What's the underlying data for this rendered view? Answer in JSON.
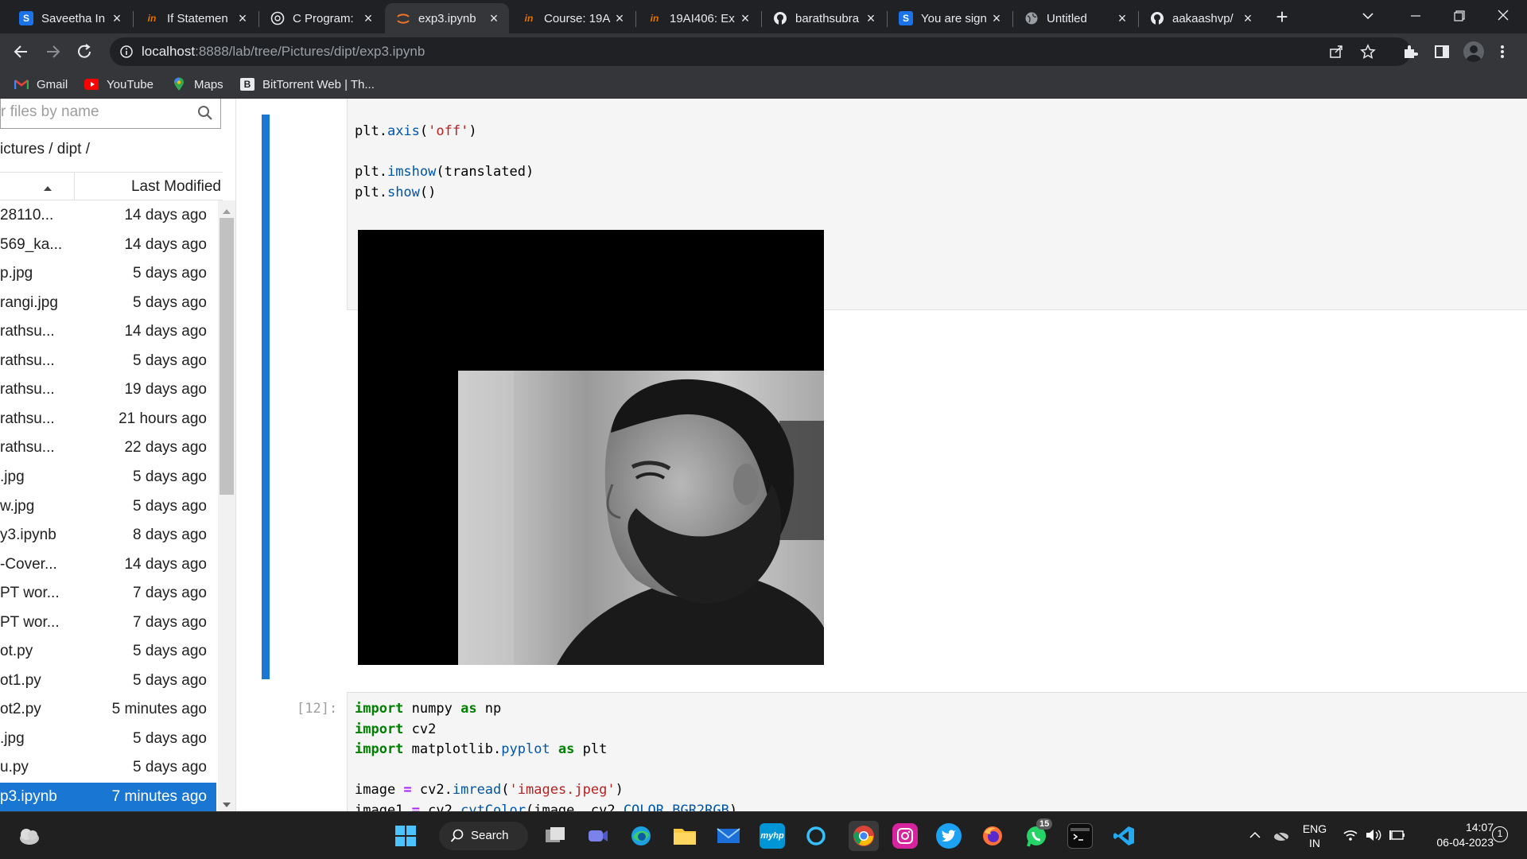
{
  "browser": {
    "tabs": [
      {
        "title": "Saveetha In",
        "icon": "saveetha-s-icon",
        "color": "#1a73e8"
      },
      {
        "title": "If Statemen",
        "icon": "unstop-icon",
        "color": "#e37400"
      },
      {
        "title": "C Program:",
        "icon": "chatgpt-icon",
        "color": "#10a37f"
      },
      {
        "title": "exp3.ipynb",
        "icon": "jupyter-icon",
        "color": "#f37626",
        "active": true
      },
      {
        "title": "Course: 19A",
        "icon": "unstop-icon",
        "color": "#e37400"
      },
      {
        "title": "19AI406: Ex",
        "icon": "unstop-icon",
        "color": "#e37400"
      },
      {
        "title": "barathsubra",
        "icon": "github-icon",
        "color": "#ffffff"
      },
      {
        "title": "You are sign",
        "icon": "saveetha-s-icon",
        "color": "#1a73e8"
      },
      {
        "title": "Untitled",
        "icon": "globe-icon",
        "color": "#9aa0a6"
      },
      {
        "title": "aakaashvp/",
        "icon": "github-icon",
        "color": "#ffffff"
      }
    ],
    "url_host": "localhost",
    "url_path": ":8888/lab/tree/Pictures/dipt/exp3.ipynb",
    "bookmarks": [
      {
        "label": "Gmail",
        "icon": "gmail-icon"
      },
      {
        "label": "YouTube",
        "icon": "youtube-icon"
      },
      {
        "label": "Maps",
        "icon": "maps-icon"
      },
      {
        "label": "BitTorrent Web | Th...",
        "icon": "bittorrent-icon"
      }
    ]
  },
  "filebrowser": {
    "search_placeholder": "r files by name",
    "breadcrumb": "ictures / dipt /",
    "col_modified": "Last Modified",
    "files": [
      {
        "name": "28110...",
        "modified": "14 days ago"
      },
      {
        "name": "569_ka...",
        "modified": "14 days ago"
      },
      {
        "name": "p.jpg",
        "modified": "5 days ago"
      },
      {
        "name": "rangi.jpg",
        "modified": "5 days ago"
      },
      {
        "name": "rathsu...",
        "modified": "14 days ago"
      },
      {
        "name": "rathsu...",
        "modified": "5 days ago"
      },
      {
        "name": "rathsu...",
        "modified": "19 days ago"
      },
      {
        "name": "rathsu...",
        "modified": "21 hours ago"
      },
      {
        "name": "rathsu...",
        "modified": "22 days ago"
      },
      {
        "name": ".jpg",
        "modified": "5 days ago"
      },
      {
        "name": "w.jpg",
        "modified": "5 days ago"
      },
      {
        "name": "y3.ipynb",
        "modified": "8 days ago"
      },
      {
        "name": "-Cover...",
        "modified": "14 days ago"
      },
      {
        "name": "PT wor...",
        "modified": "7 days ago"
      },
      {
        "name": "PT wor...",
        "modified": "7 days ago"
      },
      {
        "name": "ot.py",
        "modified": "5 days ago"
      },
      {
        "name": "ot1.py",
        "modified": "5 days ago"
      },
      {
        "name": "ot2.py",
        "modified": "5 minutes ago"
      },
      {
        "name": ".jpg",
        "modified": "5 days ago"
      },
      {
        "name": "u.py",
        "modified": "5 days ago"
      },
      {
        "name": "p3.ipynb",
        "modified": "7 minutes ago",
        "selected": true
      }
    ]
  },
  "notebook": {
    "cell1_lines": [
      [
        {
          "t": "plt.",
          "c": ""
        },
        {
          "t": "axis",
          "c": "fnc"
        },
        {
          "t": "(",
          "c": ""
        },
        {
          "t": "'off'",
          "c": "str"
        },
        {
          "t": ")",
          "c": ""
        }
      ],
      [],
      [
        {
          "t": "plt.",
          "c": ""
        },
        {
          "t": "imshow",
          "c": "fnc"
        },
        {
          "t": "(translated)",
          "c": ""
        }
      ],
      [
        {
          "t": "plt.",
          "c": ""
        },
        {
          "t": "show",
          "c": "fnc"
        },
        {
          "t": "()",
          "c": ""
        }
      ]
    ],
    "cell2_prompt": "[12]:",
    "cell2_lines": [
      [
        {
          "t": "import",
          "c": "kw"
        },
        {
          "t": " numpy ",
          "c": ""
        },
        {
          "t": "as",
          "c": "kw"
        },
        {
          "t": " np",
          "c": ""
        }
      ],
      [
        {
          "t": "import",
          "c": "kw"
        },
        {
          "t": " cv2",
          "c": ""
        }
      ],
      [
        {
          "t": "import",
          "c": "kw"
        },
        {
          "t": " matplotlib.",
          "c": ""
        },
        {
          "t": "pyplot",
          "c": "fnc"
        },
        {
          "t": " ",
          "c": ""
        },
        {
          "t": "as",
          "c": "kw"
        },
        {
          "t": " plt",
          "c": ""
        }
      ],
      [],
      [
        {
          "t": "image ",
          "c": ""
        },
        {
          "t": "=",
          "c": "op"
        },
        {
          "t": " cv2.",
          "c": ""
        },
        {
          "t": "imread",
          "c": "fnc"
        },
        {
          "t": "(",
          "c": ""
        },
        {
          "t": "'images.jpeg'",
          "c": "str"
        },
        {
          "t": ")",
          "c": ""
        }
      ],
      [
        {
          "t": "image1 ",
          "c": ""
        },
        {
          "t": "=",
          "c": "op"
        },
        {
          "t": " cv2.",
          "c": ""
        },
        {
          "t": "cvtColor",
          "c": "fnc"
        },
        {
          "t": "(image, cv2.",
          "c": ""
        },
        {
          "t": "COLOR_BGR2RGB",
          "c": "cst"
        },
        {
          "t": ")",
          "c": ""
        }
      ]
    ],
    "output_image_alt": "translated grayscale photo output"
  },
  "taskbar": {
    "search_label": "Search",
    "lang_top": "ENG",
    "lang_bottom": "IN",
    "time": "14:07",
    "date": "06-04-2023",
    "notification_count": "1",
    "whatsapp_badge": "15"
  }
}
